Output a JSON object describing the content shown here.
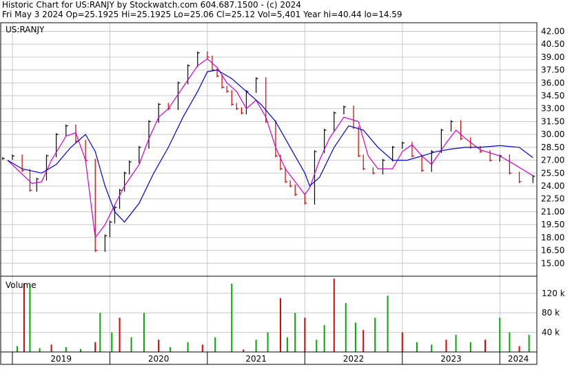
{
  "header": {
    "line1": "Historic Chart for US:RANJY by Stockwatch.com 604.687.1500 - (c) 2024",
    "line2": "Fri May  3 2024   Op=25.1925   Hi=25.1925   Lo=25.06   Cl=25.12   Vol=5,401   Year hi=40.44   lo=14.59"
  },
  "colors": {
    "price_bar_up": "#000000",
    "price_bar_down": "#cc0000",
    "ma_short": "#cc00cc",
    "ma_long": "#0000cc",
    "volume_up": "#00aa00",
    "volume_down": "#dd0000",
    "grid": "#c8c8c8"
  },
  "chart_data": [
    {
      "type": "line",
      "title": "US:RANJY",
      "x_tick_labels": [
        "2019",
        "2020",
        "2021",
        "2022",
        "2023",
        "2024"
      ],
      "y_tick_labels": [
        "42.00",
        "40.50",
        "39.00",
        "37.50",
        "36.00",
        "34.50",
        "33.00",
        "31.50",
        "30.00",
        "28.50",
        "27.00",
        "25.50",
        "24.00",
        "22.50",
        "21.00",
        "19.50",
        "18.00",
        "16.50",
        "15.00"
      ],
      "ylim": [
        13.5,
        43.0
      ],
      "grid": true,
      "series": [
        {
          "role": "price",
          "x": [
            2018.9,
            2019.0,
            2019.1,
            2019.18,
            2019.25,
            2019.35,
            2019.45,
            2019.55,
            2019.65,
            2019.75,
            2019.85,
            2019.95,
            2020.0,
            2020.05,
            2020.1,
            2020.15,
            2020.2,
            2020.3,
            2020.4,
            2020.5,
            2020.6,
            2020.7,
            2020.8,
            2020.9,
            2021.0,
            2021.05,
            2021.1,
            2021.15,
            2021.2,
            2021.25,
            2021.3,
            2021.35,
            2021.4,
            2021.5,
            2021.6,
            2021.7,
            2021.75,
            2021.8,
            2021.85,
            2021.9,
            2022.0,
            2022.1,
            2022.2,
            2022.3,
            2022.4,
            2022.5,
            2022.55,
            2022.6,
            2022.7,
            2022.8,
            2022.9,
            2023.0,
            2023.1,
            2023.2,
            2023.3,
            2023.4,
            2023.5,
            2023.6,
            2023.7,
            2023.8,
            2023.9,
            2024.0,
            2024.1,
            2024.2,
            2024.34
          ],
          "values": [
            27.2,
            27.5,
            25.8,
            23.5,
            24.8,
            27.5,
            30.0,
            31.0,
            29.2,
            27.0,
            16.5,
            18.2,
            19.8,
            21.5,
            23.5,
            25.5,
            26.8,
            28.5,
            31.5,
            33.5,
            33.0,
            36.0,
            38.0,
            39.5,
            39.0,
            37.5,
            36.8,
            35.5,
            35.0,
            33.5,
            33.0,
            32.5,
            35.0,
            36.5,
            31.5,
            27.5,
            26.0,
            24.5,
            24.0,
            23.0,
            22.0,
            28.0,
            30.5,
            32.5,
            33.2,
            30.8,
            27.5,
            26.0,
            25.5,
            27.0,
            28.5,
            29.0,
            27.5,
            25.8,
            28.0,
            30.5,
            31.5,
            29.5,
            28.5,
            28.0,
            27.0,
            27.5,
            25.5,
            24.5,
            25.12
          ]
        },
        {
          "role": "short moving average",
          "x": [
            2018.95,
            2019.2,
            2019.3,
            2019.4,
            2019.55,
            2019.65,
            2019.75,
            2019.85,
            2019.95,
            2020.05,
            2020.15,
            2020.3,
            2020.4,
            2020.5,
            2020.6,
            2020.75,
            2020.9,
            2021.0,
            2021.1,
            2021.2,
            2021.3,
            2021.4,
            2021.5,
            2021.6,
            2021.7,
            2021.8,
            2021.9,
            2022.0,
            2022.05,
            2022.15,
            2022.25,
            2022.4,
            2022.55,
            2022.65,
            2022.75,
            2022.9,
            2023.0,
            2023.1,
            2023.2,
            2023.3,
            2023.45,
            2023.55,
            2023.65,
            2023.8,
            2024.0,
            2024.15,
            2024.34
          ],
          "values": [
            27.0,
            24.3,
            24.5,
            27.0,
            29.8,
            30.2,
            27.0,
            18.0,
            19.5,
            21.8,
            24.0,
            26.5,
            29.5,
            32.0,
            33.0,
            35.5,
            38.0,
            38.8,
            37.8,
            36.0,
            35.0,
            33.0,
            34.0,
            32.0,
            28.5,
            26.0,
            24.5,
            23.0,
            23.8,
            27.0,
            29.5,
            32.0,
            31.5,
            27.5,
            26.0,
            26.0,
            28.0,
            28.8,
            27.5,
            26.5,
            29.0,
            30.5,
            29.5,
            28.2,
            27.5,
            26.5,
            25.2
          ]
        },
        {
          "role": "long moving average",
          "x": [
            2018.95,
            2019.1,
            2019.3,
            2019.45,
            2019.6,
            2019.75,
            2019.85,
            2019.95,
            2020.05,
            2020.15,
            2020.3,
            2020.45,
            2020.6,
            2020.75,
            2020.9,
            2021.0,
            2021.1,
            2021.25,
            2021.4,
            2021.55,
            2021.7,
            2021.85,
            2022.0,
            2022.05,
            2022.15,
            2022.3,
            2022.45,
            2022.6,
            2022.75,
            2022.9,
            2023.05,
            2023.2,
            2023.35,
            2023.5,
            2023.65,
            2023.8,
            2024.0,
            2024.2,
            2024.34
          ],
          "values": [
            27.0,
            26.0,
            25.5,
            26.5,
            28.5,
            30.0,
            28.0,
            24.0,
            21.0,
            19.8,
            22.0,
            25.5,
            28.5,
            32.0,
            35.0,
            37.3,
            37.5,
            36.5,
            35.0,
            33.5,
            31.5,
            28.5,
            25.5,
            24.0,
            25.0,
            28.5,
            31.0,
            30.5,
            28.5,
            27.0,
            27.0,
            27.5,
            28.0,
            28.3,
            28.5,
            28.5,
            28.7,
            28.5,
            27.3
          ]
        }
      ]
    },
    {
      "type": "bar",
      "title": "Volume",
      "y_tick_labels": [
        "120 k",
        "80 k",
        "40 k"
      ],
      "ylim": [
        0,
        155
      ],
      "x": [
        2019.05,
        2019.12,
        2019.18,
        2019.28,
        2019.4,
        2019.55,
        2019.7,
        2019.85,
        2019.9,
        2020.02,
        2020.1,
        2020.22,
        2020.35,
        2020.5,
        2020.62,
        2020.8,
        2020.95,
        2021.08,
        2021.25,
        2021.37,
        2021.5,
        2021.62,
        2021.75,
        2021.82,
        2021.9,
        2022.0,
        2022.12,
        2022.2,
        2022.3,
        2022.42,
        2022.52,
        2022.6,
        2022.72,
        2022.85,
        2023.0,
        2023.15,
        2023.3,
        2023.45,
        2023.55,
        2023.7,
        2023.85,
        2024.0,
        2024.1,
        2024.2,
        2024.3
      ],
      "values": [
        12,
        140,
        138,
        8,
        15,
        10,
        6,
        20,
        80,
        40,
        70,
        30,
        80,
        25,
        10,
        20,
        15,
        30,
        140,
        5,
        25,
        40,
        110,
        30,
        80,
        70,
        25,
        55,
        150,
        100,
        60,
        45,
        70,
        115,
        40,
        20,
        15,
        25,
        35,
        20,
        25,
        70,
        40,
        12,
        35
      ]
    }
  ]
}
